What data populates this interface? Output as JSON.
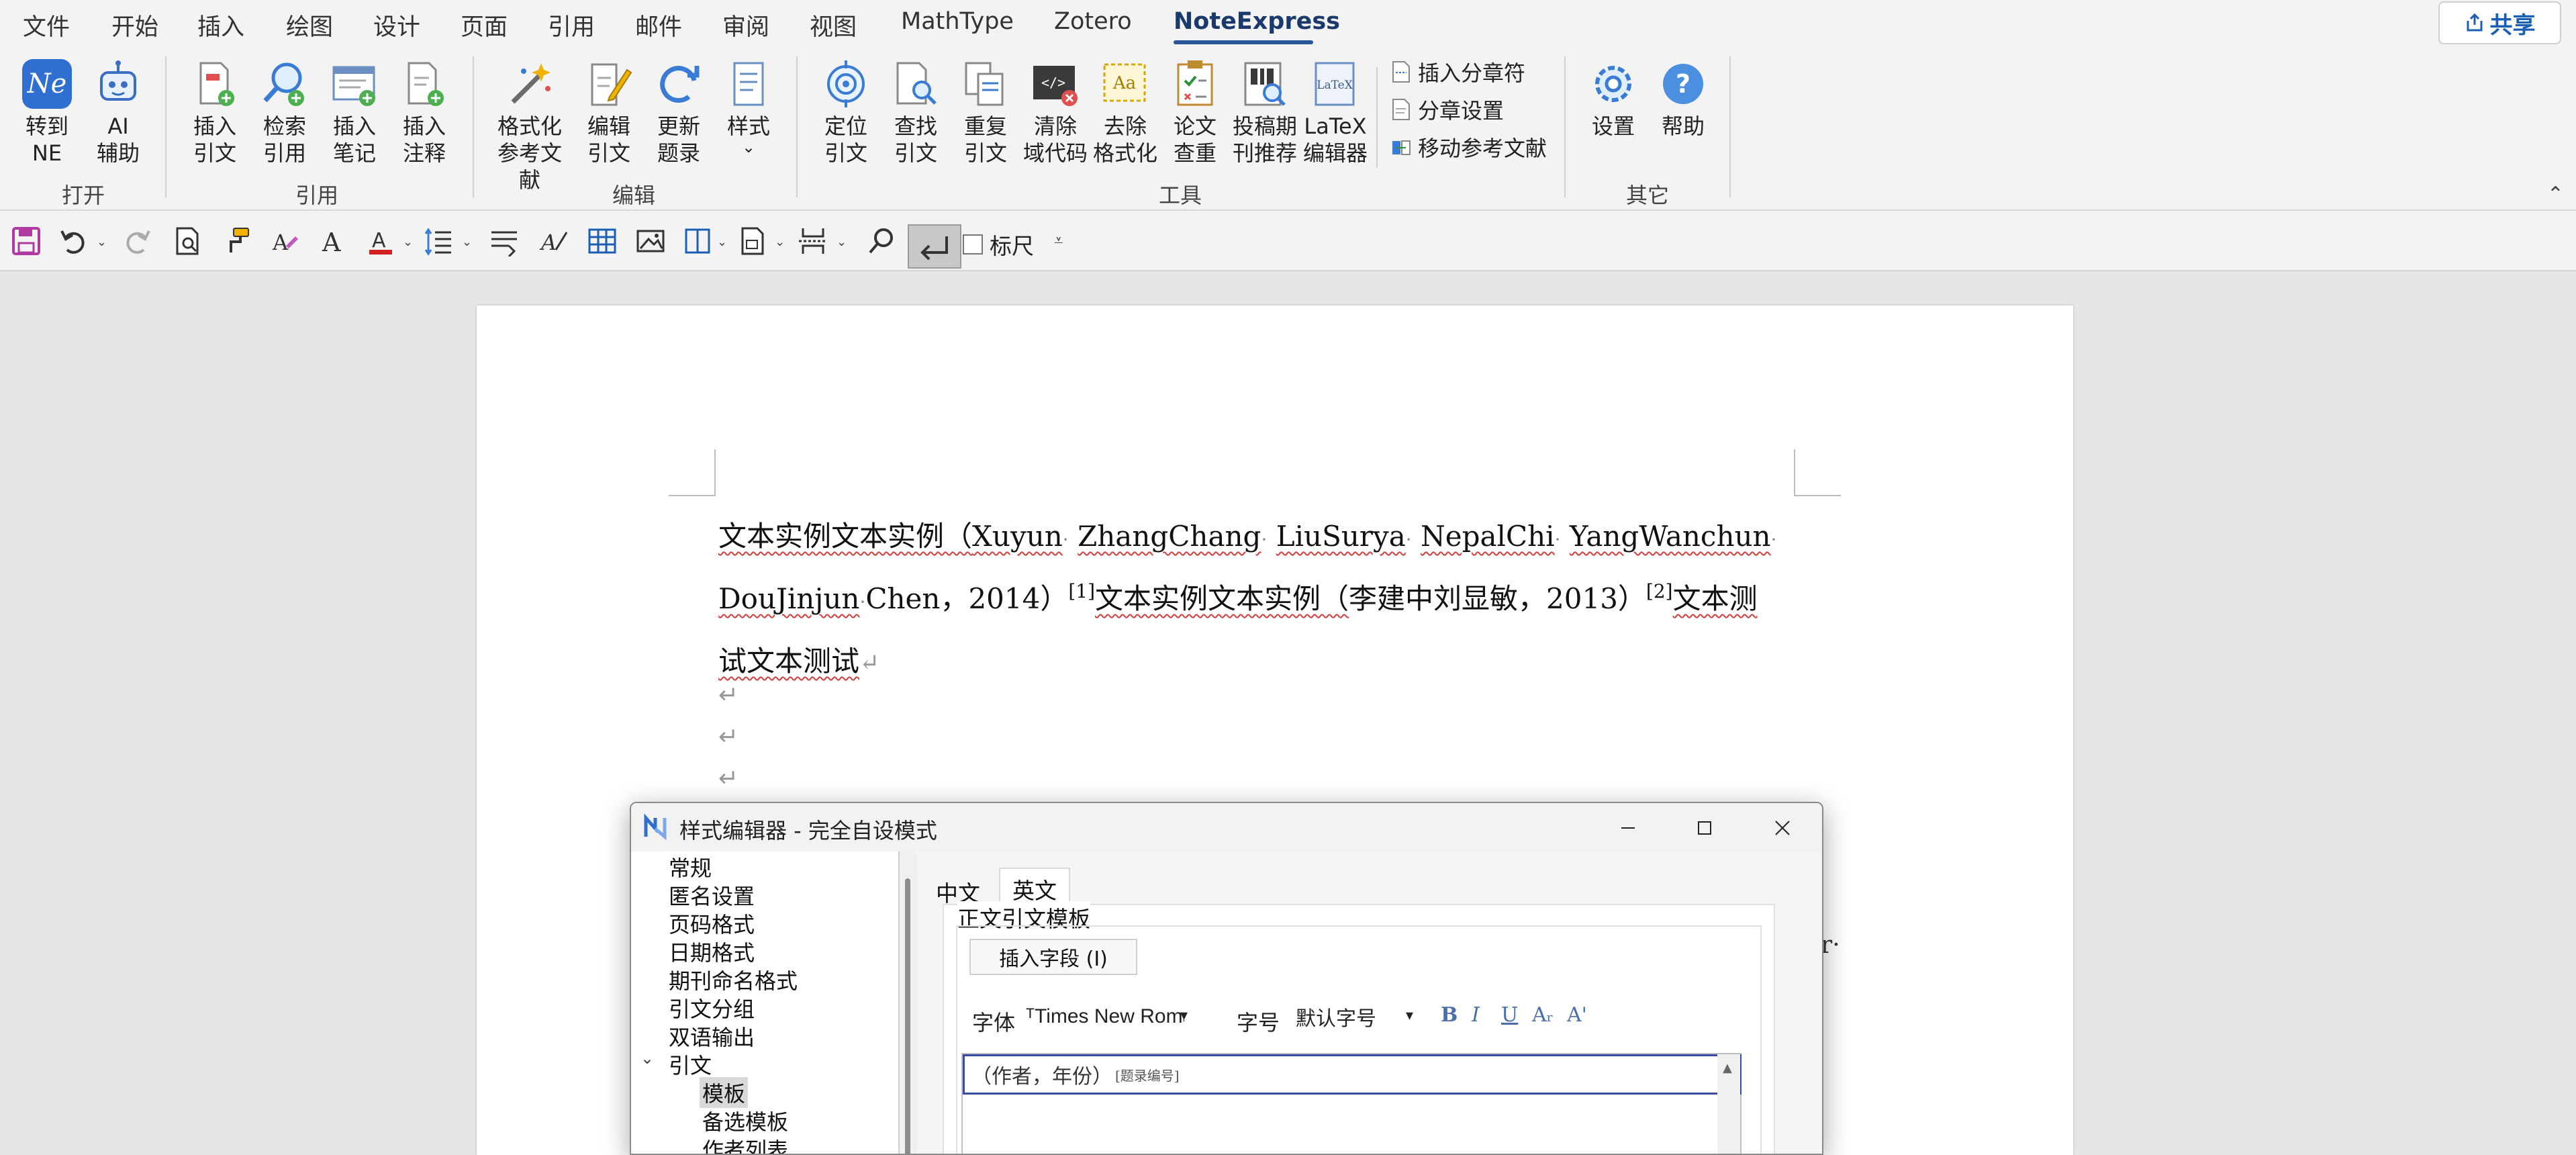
{
  "tabs": [
    {
      "label": "文件"
    },
    {
      "label": "开始"
    },
    {
      "label": "插入"
    },
    {
      "label": "绘图"
    },
    {
      "label": "设计"
    },
    {
      "label": "页面"
    },
    {
      "label": "引用"
    },
    {
      "label": "邮件"
    },
    {
      "label": "审阅"
    },
    {
      "label": "视图"
    },
    {
      "label": "MathType"
    },
    {
      "label": "Zotero"
    },
    {
      "label": "NoteExpress"
    }
  ],
  "share_label": "共享",
  "ribbon": {
    "groups": {
      "open": "打开",
      "cite": "引用",
      "edit": "编辑",
      "tools": "工具",
      "other": "其它"
    },
    "buttons": {
      "to_ne": [
        "转到",
        "NE"
      ],
      "ai": [
        "AI",
        "辅助"
      ],
      "insert_cite": [
        "插入",
        "引文"
      ],
      "search_cite": [
        "检索",
        "引用"
      ],
      "insert_note": [
        "插入",
        "笔记"
      ],
      "insert_annot": [
        "插入",
        "注释"
      ],
      "format_refs": [
        "格式化",
        "参考文献"
      ],
      "edit_cite": [
        "编辑",
        "引文"
      ],
      "update_records": [
        "更新",
        "题录"
      ],
      "style": [
        "样式",
        "⌄"
      ],
      "locate_cite": [
        "定位",
        "引文"
      ],
      "find_cite": [
        "查找",
        "引文"
      ],
      "dup_cite": [
        "重复",
        "引文"
      ],
      "clear_field": [
        "清除",
        "域代码"
      ],
      "remove_format": [
        "去除",
        "格式化"
      ],
      "paper_check": [
        "论文",
        "查重"
      ],
      "journal_rec": [
        "投稿期",
        "刊推荐"
      ],
      "latex": [
        "LaTeX",
        "编辑器"
      ],
      "settings": [
        "设置"
      ],
      "help": [
        "帮助"
      ]
    },
    "small_items": [
      "插入分章符",
      "分章设置",
      "移动参考文献"
    ]
  },
  "qat": {
    "ruler_label": "标尺"
  },
  "document": {
    "p1_a": "文本实例文本实例（",
    "authors": [
      "Xuyun",
      "ZhangChang",
      "LiuSurya",
      "NepalChi",
      "YangWanchun",
      "DouJinjun"
    ],
    "p1_b": "Chen，2014）",
    "sup1": "[1]",
    "p1_c": "文本实例文本实例（",
    "p1_d": "李建中刘显敏，2013）",
    "sup2": "[2]",
    "p1_e": "文本测",
    "p1_f": "试文本测试",
    "pilcrow": "↵",
    "trail_char": "r·"
  },
  "dialog": {
    "title": "样式编辑器 - 完全自设模式",
    "tree": [
      "常规",
      "匿名设置",
      "页码格式",
      "日期格式",
      "期刊命名格式",
      "引文分组",
      "双语输出",
      "引文",
      "模板",
      "备选模板",
      "作者列表"
    ],
    "tree_expand_icon": "⌄",
    "tabs": [
      "中文",
      "英文"
    ],
    "panel_title": "正文引文模板",
    "insert_field": "插入字段 (I)",
    "font_label": "字体",
    "font_value": "ᵀTimes New Roman",
    "size_label": "字号",
    "size_value": "默认字号",
    "format_buttons": [
      "B",
      "I",
      "U",
      "Aᵣ",
      "A'"
    ],
    "template_text": "（作者，年份）",
    "template_tag": "[题录编号]"
  }
}
